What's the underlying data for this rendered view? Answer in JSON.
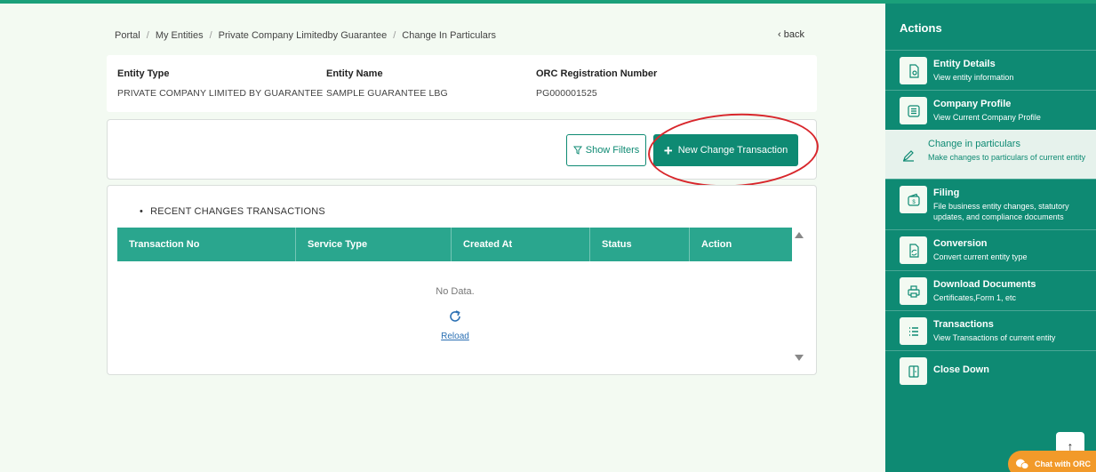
{
  "breadcrumb": {
    "items": [
      "Portal",
      "My Entities",
      "Private Company Limitedby Guarantee",
      "Change In Particulars"
    ],
    "separator": "/"
  },
  "back_label": "back",
  "entity": {
    "type_label": "Entity Type",
    "type_value": "PRIVATE COMPANY LIMITED BY GUARANTEE",
    "name_label": "Entity Name",
    "name_value": "SAMPLE GUARANTEE LBG",
    "reg_label": "ORC Registration Number",
    "reg_value": "PG000001525"
  },
  "actions": {
    "show_filters": "Show Filters",
    "new_change": "New Change Transaction"
  },
  "table": {
    "section_title": "RECENT CHANGES TRANSACTIONS",
    "columns": [
      "Transaction No",
      "Service Type",
      "Created At",
      "Status",
      "Action"
    ],
    "empty_text": "No Data.",
    "reload_label": "Reload"
  },
  "sidebar": {
    "title": "Actions",
    "items": [
      {
        "title": "Entity Details",
        "desc": "View entity information",
        "icon": "document-search-icon"
      },
      {
        "title": "Company Profile",
        "desc": "View Current Company Profile",
        "icon": "list-document-icon"
      },
      {
        "title": "Change in particulars",
        "desc": "Make changes to particulars of current entity",
        "icon": "pencil-icon"
      },
      {
        "title": "Filing",
        "desc": "File business entity changes, statutory updates, and compliance documents",
        "icon": "wallet-icon"
      },
      {
        "title": "Conversion",
        "desc": "Convert current entity type",
        "icon": "document-convert-icon"
      },
      {
        "title": "Download Documents",
        "desc": "Certificates,Form 1, etc",
        "icon": "printer-icon"
      },
      {
        "title": "Transactions",
        "desc": "View Transactions of current entity",
        "icon": "list-icon"
      },
      {
        "title": "Close Down",
        "desc": "",
        "icon": "door-exit-icon"
      }
    ]
  },
  "chat_label": "Chat with ORC",
  "colors": {
    "brand": "#0e8a73",
    "table_header": "#2aa68e",
    "annotation": "#d8262b",
    "chat": "#f29a2a"
  }
}
